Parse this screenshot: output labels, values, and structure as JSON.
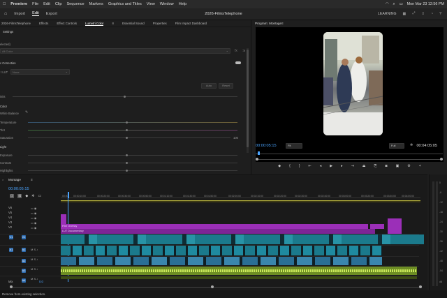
{
  "menubar": {
    "apple": "",
    "app": "Premiere",
    "items": [
      "File",
      "Edit",
      "Clip",
      "Sequence",
      "Markers",
      "Graphics and Titles",
      "View",
      "Window",
      "Help"
    ],
    "datetime": "Mon Mar 23  12:56 PM"
  },
  "header": {
    "nav": [
      "Import",
      "Edit",
      "Export"
    ],
    "active": "Edit",
    "title": "2026-FilmsTelephone",
    "right": [
      "LEARNING"
    ]
  },
  "left_panel": {
    "tabs": [
      "2026-FilmsTelephone",
      "Effects",
      "Effect Controls",
      "Lumetri Color",
      "Essential Sound",
      "Properties",
      "Film Impact Dashboard"
    ],
    "active": "Lumetri Color",
    "settings": "Settings",
    "selected_label": "elected)",
    "selected_value": "All Color",
    "section": "c Correction",
    "lut_label": "t LUT",
    "lut_value": "None",
    "auto": "Auto",
    "reset": "Reset",
    "inits": "inits",
    "color": "Color",
    "white_balance": "White Balance",
    "temperature": "Temperature",
    "tint": "Tint",
    "saturation": "Saturation",
    "saturation_value": "100",
    "light": "Light",
    "exposure": "Exposure",
    "contrast": "Contrast",
    "highlights": "Highlights"
  },
  "program": {
    "title": "Program: Montage",
    "timecode": "00:00:05:15",
    "fit": "Fit",
    "full": "Full",
    "duration": "00:04:05:05"
  },
  "timeline": {
    "title": "Montage",
    "timecode": "00:00:05:15",
    "ruler": [
      "00:00",
      "00:00:10:00",
      "00:00:20:00",
      "00:00:30:00",
      "00:00:40:00",
      "00:00:50:00",
      "00:01:00:00",
      "00:01:10:00",
      "00:01:20:00",
      "00:01:30:00",
      "00:01:40:00",
      "00:01:50:00",
      "00:02:00:00",
      "00:02:10:00",
      "00:02:20:00",
      "00:02:30:00",
      "00:02:40:00",
      "00:02:50:00",
      "00:03:00:00",
      "00:03:10:00",
      "00:03:20:00",
      "00:03:30:00",
      "00:03:40:00",
      "00:03:50:00",
      "00:04:00:00"
    ],
    "video_tracks": [
      "V6",
      "V5",
      "V4",
      "V3",
      "V2",
      "V1"
    ],
    "audio_tracks": [
      "A1",
      "A2",
      "A3",
      "A4"
    ],
    "mix": "Mix",
    "mix_value": "0.0",
    "clip_film_overlay": "Film Overlay",
    "clip_lut": "LUT Documentary"
  },
  "meter": {
    "labels": [
      "0",
      "-6",
      "-12",
      "-18",
      "-24",
      "-30",
      "-36",
      "-42",
      "-48",
      "-54",
      "dB"
    ]
  },
  "status": {
    "text": "Remove from existing selection."
  },
  "colors": {
    "accent": "#4aa4ff",
    "video": "#1b7a8c",
    "overlay": "#9b2fb8",
    "audio_green": "#9ac73a"
  }
}
